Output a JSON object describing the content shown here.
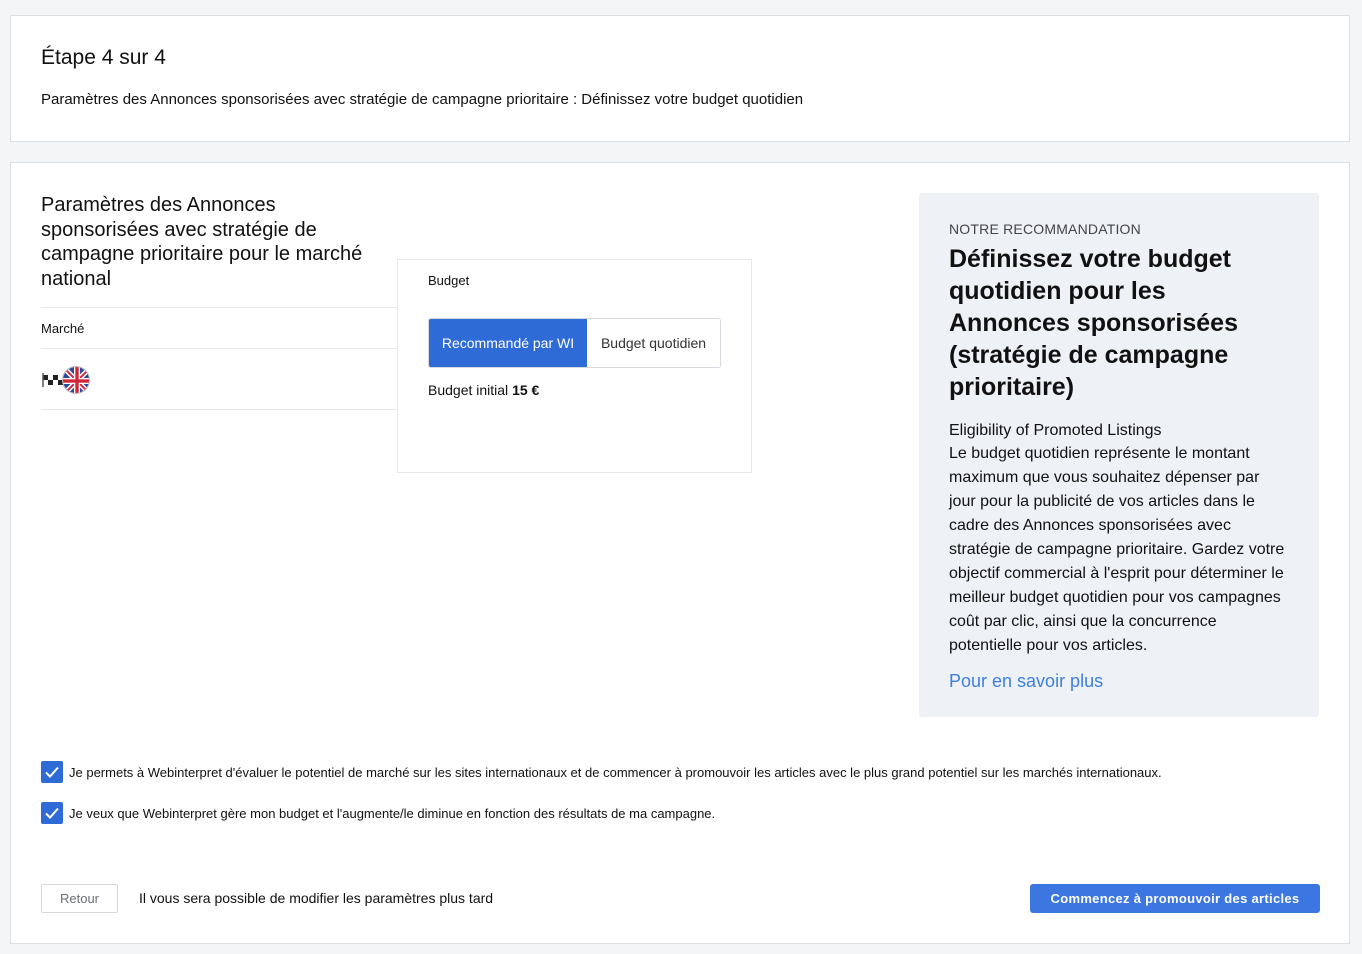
{
  "step": {
    "title": "Étape 4 sur 4",
    "subtitle": "Paramètres des Annonces sponsorisées avec stratégie de campagne prioritaire : Définissez votre budget quotidien"
  },
  "section": {
    "title": "Paramètres des Annonces sponsorisées avec stratégie de campagne prioritaire pour le marché national"
  },
  "market_table": {
    "header": "Marché",
    "rows": [
      {
        "icons": [
          "ebay-flag-icon",
          "uk-flag-icon"
        ]
      }
    ]
  },
  "budget": {
    "label": "Budget",
    "options": [
      {
        "label": "Recommandé par WI",
        "selected": true
      },
      {
        "label": "Budget quotidien",
        "selected": false
      }
    ],
    "initial_label": "Budget initial",
    "initial_value": "15 €"
  },
  "recommendation": {
    "kicker": "NOTRE RECOMMANDATION",
    "headline": "Définissez votre budget quotidien pour les Annonces sponsorisées (stratégie de campagne prioritaire)",
    "subheading": "Eligibility of Promoted Listings",
    "body": "Le budget quotidien représente le montant maximum que vous souhaitez dépenser par jour pour la publicité de vos articles dans le cadre des Annonces sponsorisées avec stratégie de campagne prioritaire. Gardez votre objectif commercial à l'esprit pour déterminer le meilleur budget quotidien pour vos campagnes coût par clic, ainsi que la concurrence potentielle pour vos articles.",
    "link": "Pour en savoir plus"
  },
  "consents": [
    {
      "label": "Je permets à Webinterpret d'évaluer le potentiel de marché sur les sites internationaux et de commencer à promouvoir les articles avec le plus grand potentiel sur les marchés internationaux.",
      "checked": true
    },
    {
      "label": "Je veux que Webinterpret gère mon budget et l'augmente/le diminue en fonction des résultats de ma campagne.",
      "checked": true
    }
  ],
  "footer": {
    "back_label": "Retour",
    "note": "Il vous sera possible de modifier les paramètres plus tard",
    "primary_label": "Commencez à promouvoir des articles"
  },
  "colors": {
    "accent": "#2e6bd6",
    "primary_button": "#3b76e1",
    "link": "#3d7fe0",
    "reco_bg": "#eef1f6"
  }
}
